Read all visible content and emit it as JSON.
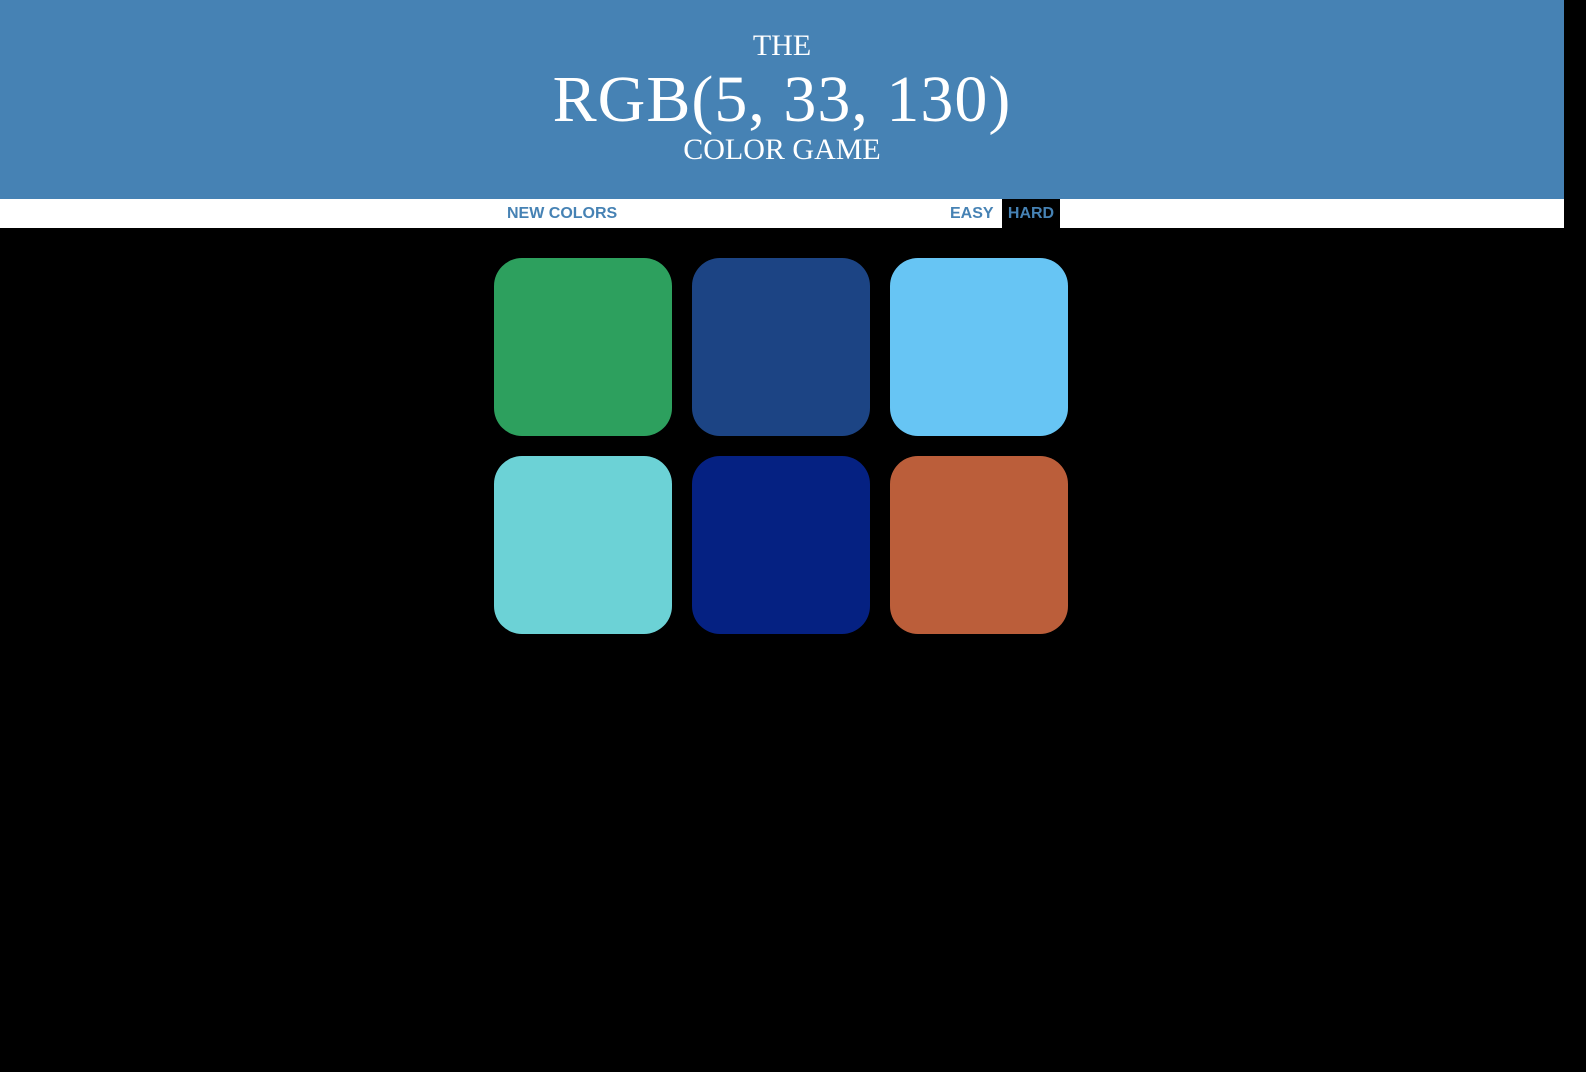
{
  "header": {
    "line1": "THE",
    "target_color": "RGB(5, 33, 130)",
    "line3": "COLOR GAME",
    "background_color": "#4682b4"
  },
  "controls": {
    "new_colors_label": "NEW COLORS",
    "easy_label": "EASY",
    "hard_label": "HARD",
    "selected_mode": "HARD",
    "accent_color": "#4682b4"
  },
  "squares": [
    {
      "color": "#2da05e"
    },
    {
      "color": "#1c4484"
    },
    {
      "color": "#67c5f4"
    },
    {
      "color": "#6cd2d6"
    },
    {
      "color": "#052182"
    },
    {
      "color": "#bb5e3a"
    }
  ],
  "page_background": "#000000"
}
